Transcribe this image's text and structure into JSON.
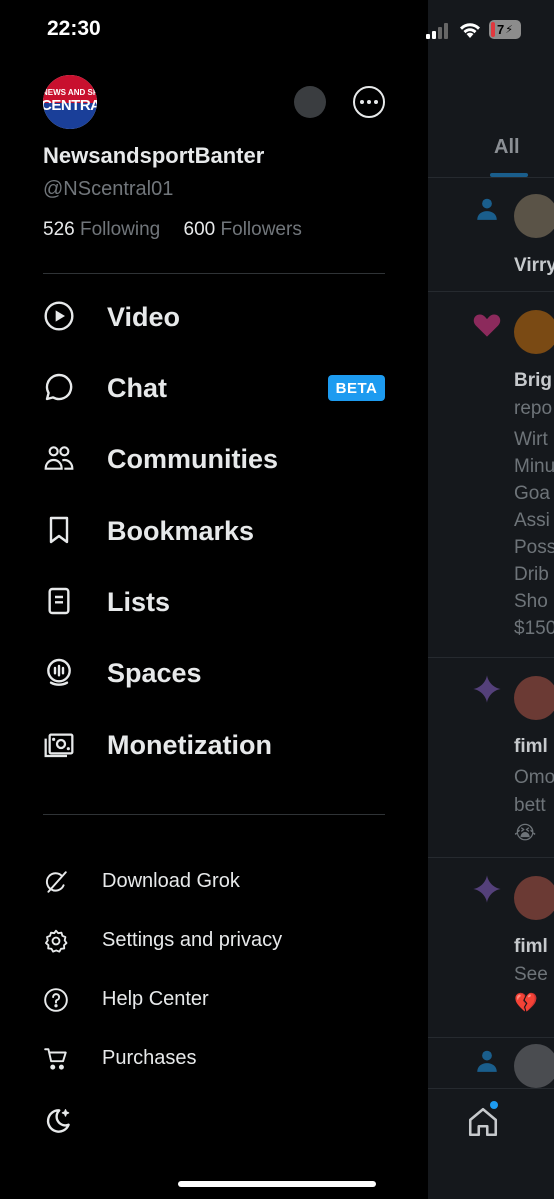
{
  "status_bar": {
    "time": "22:30",
    "battery": "7"
  },
  "profile": {
    "avatar_text_top": "NEWS AND SPORT",
    "avatar_text_main": "CENTRAL",
    "display_name": "NewsandsportBanter",
    "handle": "@NScentral01",
    "following_count": "526",
    "following_label": "Following",
    "followers_count": "600",
    "followers_label": "Followers"
  },
  "menu": {
    "video": "Video",
    "chat": "Chat",
    "chat_badge": "BETA",
    "communities": "Communities",
    "bookmarks": "Bookmarks",
    "lists": "Lists",
    "spaces": "Spaces",
    "monetization": "Monetization"
  },
  "secondary_menu": {
    "download_grok": "Download Grok",
    "settings": "Settings and privacy",
    "help": "Help Center",
    "purchases": "Purchases"
  },
  "feed": {
    "tab_all": "All",
    "posts": [
      {
        "kind_icon": "person-icon",
        "lines": [
          "Virry"
        ]
      },
      {
        "kind_icon": "heart-icon",
        "lines": [
          "Brig",
          "repo",
          "Wirt",
          "Minu",
          "Goa",
          "Assi",
          "Poss",
          "Drib",
          "Sho",
          "$150"
        ]
      },
      {
        "kind_icon": "sparkle-icon",
        "lines": [
          "fiml",
          "Omo",
          "bett",
          "😭"
        ]
      },
      {
        "kind_icon": "sparkle-icon",
        "lines": [
          "fiml",
          "See",
          "💔"
        ]
      },
      {
        "kind_icon": "person-icon",
        "lines": []
      }
    ]
  },
  "colors": {
    "background": "#000000",
    "text": "#e7e9ea",
    "muted": "#71767b",
    "accent": "#1d9bf0"
  }
}
